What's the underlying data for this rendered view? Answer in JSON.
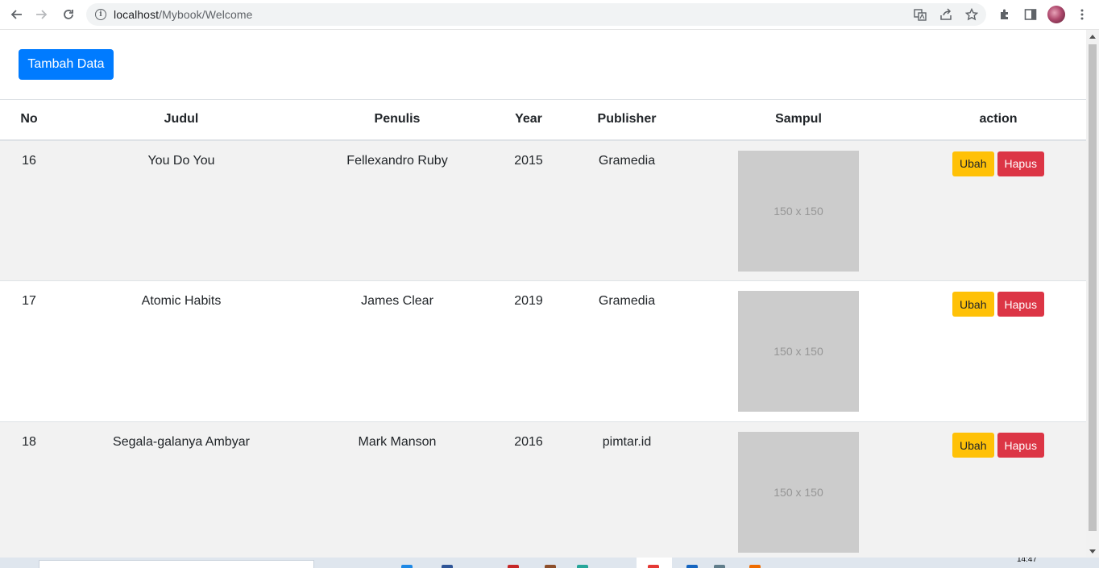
{
  "browser": {
    "url_host": "localhost",
    "url_path": "/Mybook/Welcome"
  },
  "toolbar": {
    "add_label": "Tambah Data"
  },
  "table": {
    "headers": [
      "No",
      "Judul",
      "Penulis",
      "Year",
      "Publisher",
      "Sampul",
      "action"
    ],
    "rows": [
      {
        "no": "16",
        "judul": "You Do You",
        "penulis": "Fellexandro Ruby",
        "year": "2015",
        "publisher": "Gramedia",
        "sampul": "150 x 150",
        "edit": "Ubah",
        "delete": "Hapus"
      },
      {
        "no": "17",
        "judul": "Atomic Habits",
        "penulis": "James Clear",
        "year": "2019",
        "publisher": "Gramedia",
        "sampul": "150 x 150",
        "edit": "Ubah",
        "delete": "Hapus"
      },
      {
        "no": "18",
        "judul": "Segala-galanya Ambyar",
        "penulis": "Mark Manson",
        "year": "2016",
        "publisher": "pimtar.id",
        "sampul": "150 x 150",
        "edit": "Ubah",
        "delete": "Hapus"
      }
    ]
  },
  "taskbar": {
    "clock": "14:47"
  },
  "colors": {
    "primary": "#007bff",
    "warning": "#ffc107",
    "danger": "#dc3545",
    "stripe": "#f2f2f2",
    "placeholder": "#cccccc"
  }
}
